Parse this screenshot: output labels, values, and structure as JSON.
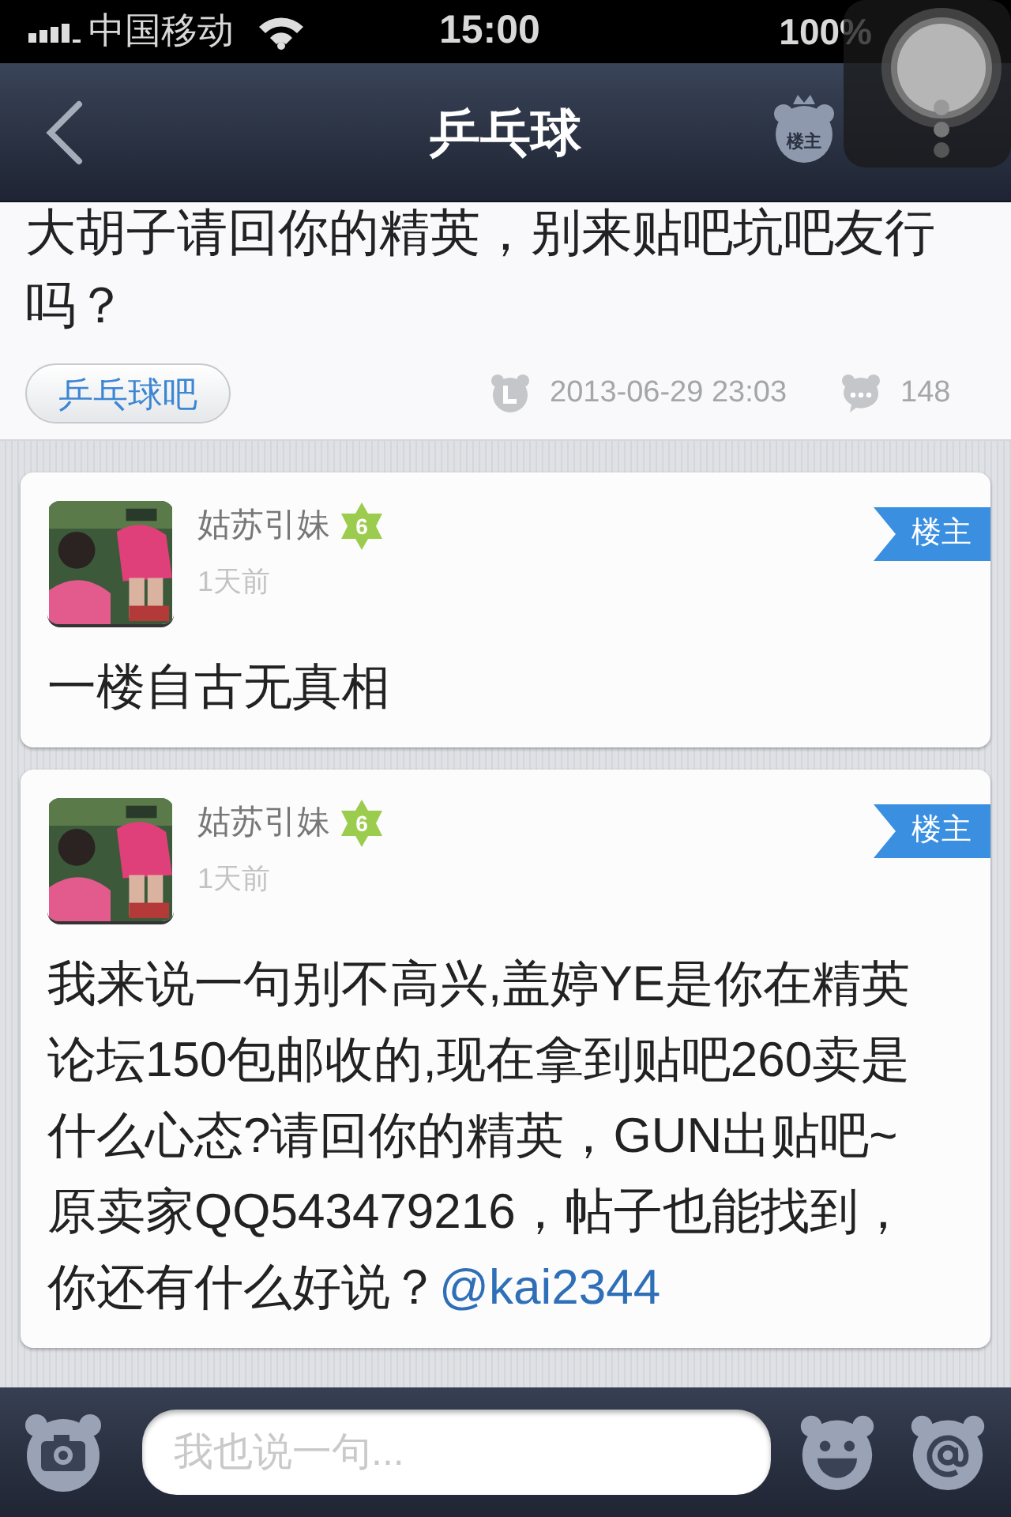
{
  "status_bar": {
    "carrier": "中国移动",
    "time": "15:00",
    "battery": "100%"
  },
  "nav": {
    "title": "乒乓球",
    "owner_badge": "楼主"
  },
  "thread": {
    "title": "大胡子请回你的精英，别来贴吧坑吧友行吗？",
    "forum": "乒乓球吧",
    "time": "2013-06-29 23:03",
    "replies": "148"
  },
  "posts": [
    {
      "author": "姑苏引妹",
      "level": "6",
      "time": "1天前",
      "badge": "楼主",
      "text": "一楼自古无真相"
    },
    {
      "author": "姑苏引妹",
      "level": "6",
      "time": "1天前",
      "badge": "楼主",
      "text": "我来说一句别不高兴,盖婷YE是你在精英论坛150包邮收的,现在拿到贴吧260卖是什么心态?请回你的精英，GUN出贴吧~原卖家QQ543479216，帖子也能找到，你还有什么好说？",
      "mention": "@kai2344"
    }
  ],
  "composer": {
    "placeholder": "我也说一句..."
  }
}
